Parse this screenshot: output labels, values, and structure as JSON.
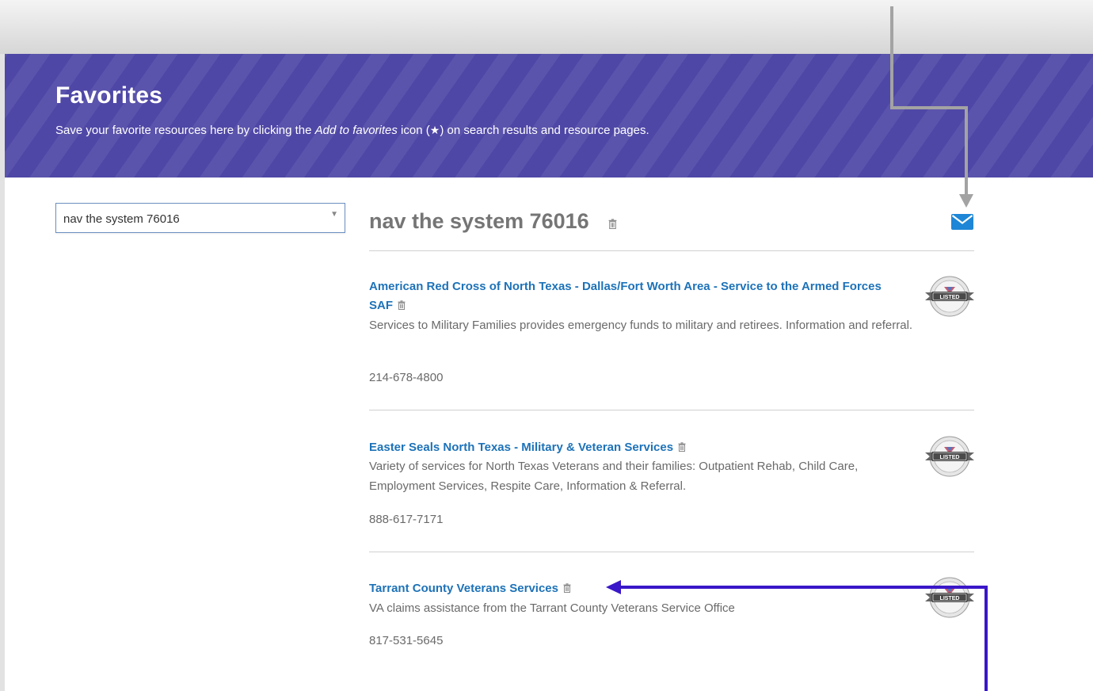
{
  "header": {
    "title": "Favorites",
    "intro_before": "Save your favorite resources here by clicking the ",
    "intro_em": "Add to favorites",
    "intro_icon_before": " icon (",
    "intro_star": "★",
    "intro_after": ") on search results and resource pages."
  },
  "list_select": {
    "value": "nav the system 76016",
    "caret": "▼"
  },
  "list": {
    "title": "nav the system 76016"
  },
  "badge": {
    "label": "LISTED"
  },
  "resources": [
    {
      "name_line1": "American Red Cross of North Texas - Dallas/Fort Worth Area - Service to the Armed Forces",
      "name_line2": "SAF",
      "description": "Services to Military Families provides emergency funds to military and retirees. Information and referral.",
      "phone": "214-678-4800"
    },
    {
      "name": "Easter Seals North Texas - Military & Veteran Services",
      "description": "Variety of services for North Texas Veterans and their families: Outpatient Rehab, Child Care, Employment Services, Respite Care, Information & Referral.",
      "phone": "888-617-7171"
    },
    {
      "name": "Tarrant County Veterans Services",
      "description": "VA claims assistance from the Tarrant County Veterans Service Office",
      "phone": "817-531-5645"
    }
  ],
  "colors": {
    "banner": "#4f47a6",
    "link": "#1d72b8",
    "annotation_gray": "#a3a3a3",
    "annotation_purple": "#3a17c8"
  }
}
